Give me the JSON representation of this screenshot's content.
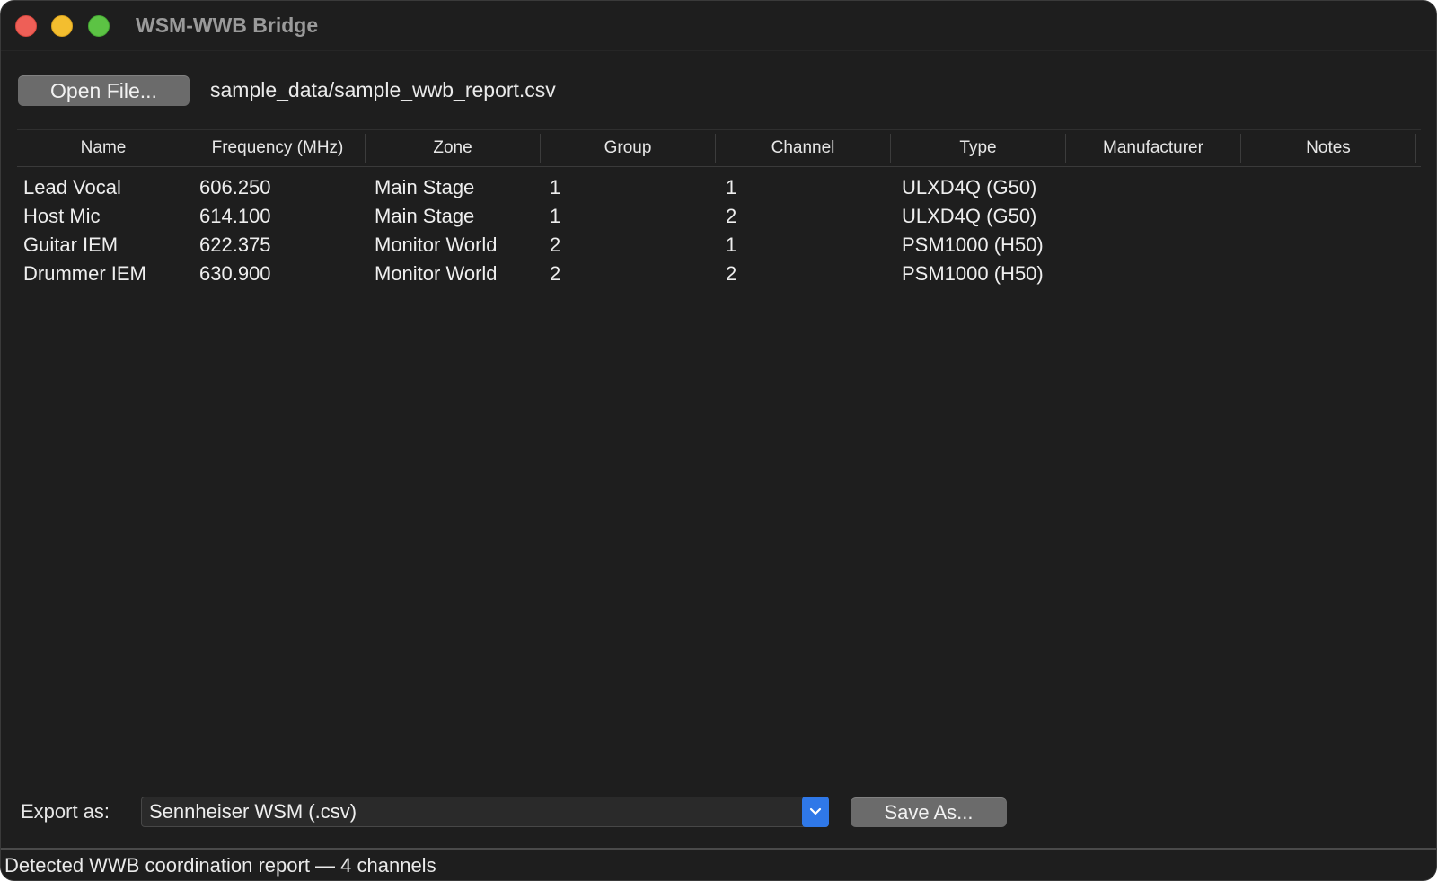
{
  "window": {
    "title": "WSM-WWB Bridge"
  },
  "toolbar": {
    "open_label": "Open File...",
    "file_path": "sample_data/sample_wwb_report.csv"
  },
  "table": {
    "columns": [
      "Name",
      "Frequency (MHz)",
      "Zone",
      "Group",
      "Channel",
      "Type",
      "Manufacturer",
      "Notes"
    ],
    "rows": [
      [
        "Lead Vocal",
        "606.250",
        "Main Stage",
        "1",
        "1",
        "ULXD4Q (G50)",
        "",
        ""
      ],
      [
        "Host Mic",
        "614.100",
        "Main Stage",
        "1",
        "2",
        "ULXD4Q (G50)",
        "",
        ""
      ],
      [
        "Guitar IEM",
        "622.375",
        "Monitor World",
        "2",
        "1",
        "PSM1000 (H50)",
        "",
        ""
      ],
      [
        "Drummer IEM",
        "630.900",
        "Monitor World",
        "2",
        "2",
        "PSM1000 (H50)",
        "",
        ""
      ]
    ]
  },
  "export": {
    "label": "Export as:",
    "selected_format": "Sennheiser WSM (.csv)",
    "save_label": "Save As..."
  },
  "status": {
    "text": "Detected WWB coordination report — 4 channels"
  },
  "colors": {
    "background": "#1e1e1e",
    "accent": "#2f78e8",
    "button": "#6b6b6b"
  }
}
